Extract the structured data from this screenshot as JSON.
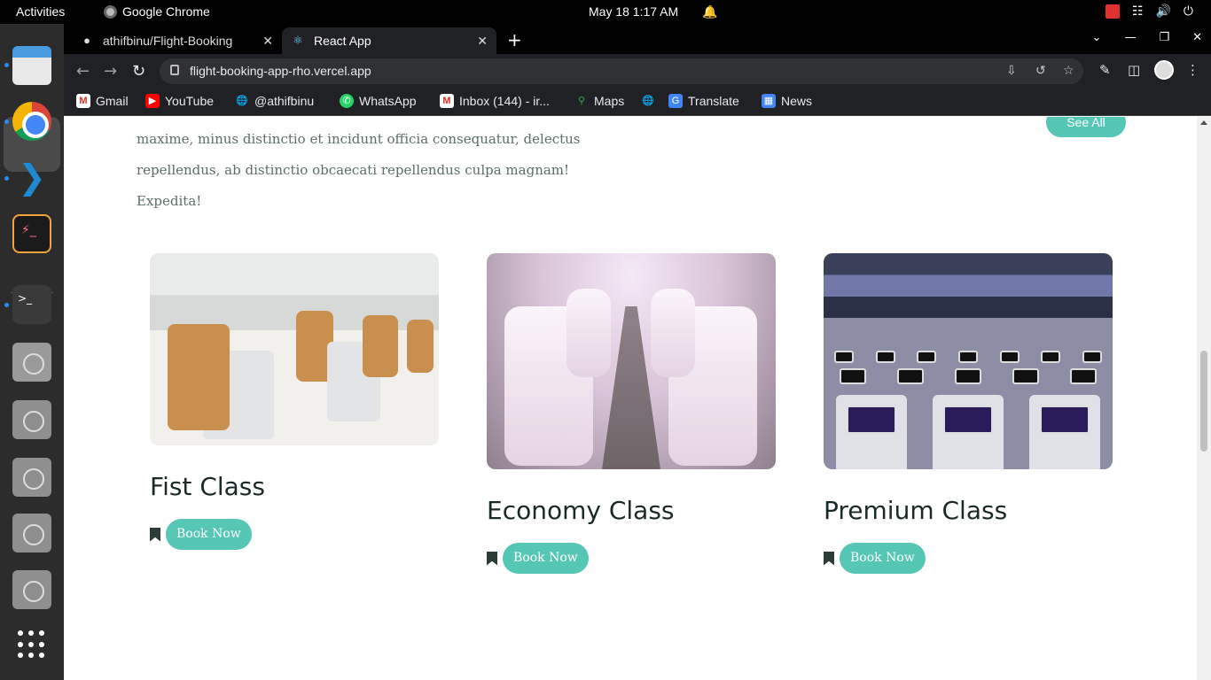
{
  "system_bar": {
    "activities": "Activities",
    "app_name": "Google Chrome",
    "clock": "May 18  1:17 AM"
  },
  "browser": {
    "tabs": [
      {
        "title": "athifbinu/Flight-Booking",
        "icon": "github-icon",
        "active": false
      },
      {
        "title": "React App",
        "icon": "react-icon",
        "active": true
      }
    ],
    "url": "flight-booking-app-rho.vercel.app",
    "bookmarks": [
      {
        "label": "Gmail",
        "icon": "gmail-icon"
      },
      {
        "label": "YouTube",
        "icon": "youtube-icon"
      },
      {
        "label": "@athifbinu",
        "icon": "globe-icon"
      },
      {
        "label": "WhatsApp",
        "icon": "whatsapp-icon"
      },
      {
        "label": "Inbox (144) - ir...",
        "icon": "gmail-icon"
      },
      {
        "label": "Maps",
        "icon": "maps-icon"
      },
      {
        "label": "",
        "icon": "globe-icon"
      },
      {
        "label": "Translate",
        "icon": "translate-icon"
      },
      {
        "label": "News",
        "icon": "news-icon"
      }
    ]
  },
  "page": {
    "intro_line_1": "maxime, minus distinctio et incidunt officia consequatur, delectus",
    "intro_line_2": "repellendus, ab distinctio obcaecati repellendus culpa magnam! Expedita!",
    "see_all": "See All",
    "cards": [
      {
        "title": "Fist Class",
        "button": "Book Now"
      },
      {
        "title": "Economy Class",
        "button": "Book Now"
      },
      {
        "title": "Premium Class",
        "button": "Book Now"
      }
    ]
  },
  "colors": {
    "accent": "#56c7b4",
    "heading": "#1b2a28",
    "body_text": "#5b6e6b"
  }
}
